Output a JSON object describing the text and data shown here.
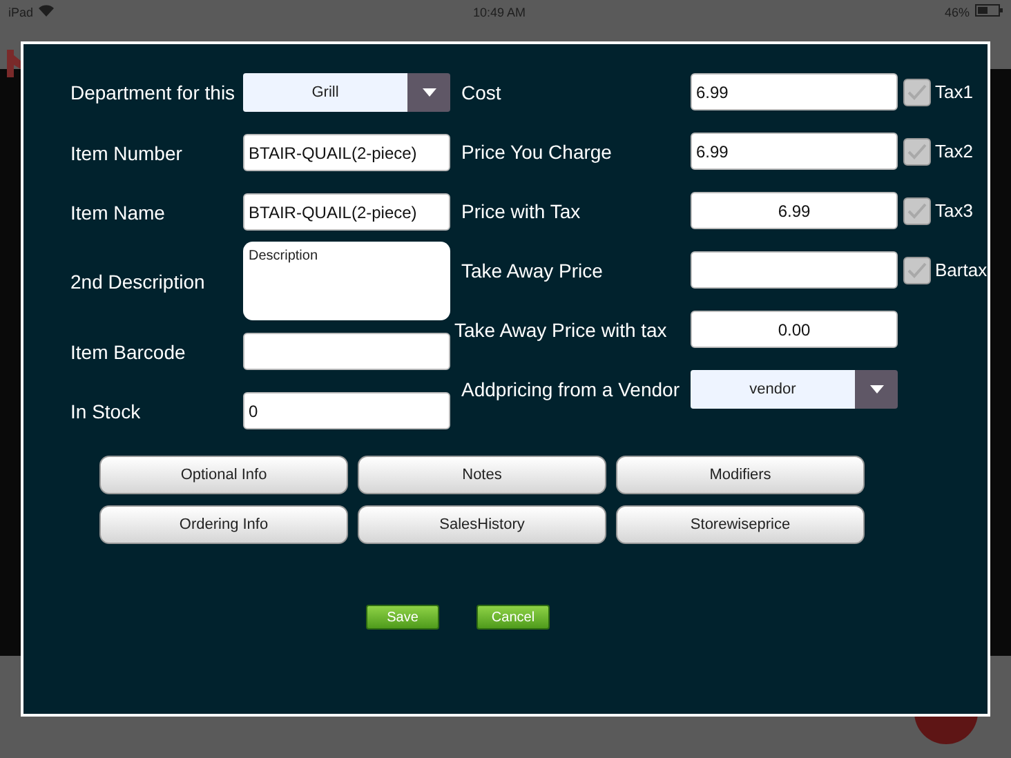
{
  "status_bar": {
    "device": "iPad",
    "time": "10:49 AM",
    "battery": "46%"
  },
  "dialog": {
    "left_fields": [
      {
        "label": "Department for this",
        "kind": "select",
        "value": "Grill"
      },
      {
        "label": "Item Number",
        "kind": "text",
        "value": "BTAIR-QUAIL(2-piece)"
      },
      {
        "label": "Item Name",
        "kind": "text",
        "value": "BTAIR-QUAIL(2-piece)"
      },
      {
        "label": "2nd Description",
        "kind": "textarea",
        "value": "Description"
      },
      {
        "label": "Item Barcode",
        "kind": "text"
      },
      {
        "label": "In Stock",
        "kind": "text",
        "value": "0"
      }
    ],
    "right_fields": [
      {
        "label": "Cost",
        "kind": "text",
        "value": "6.99",
        "tax": {
          "label": "Tax1",
          "checked": true
        }
      },
      {
        "label": "Price You Charge",
        "kind": "text",
        "value": "6.99",
        "tax": {
          "label": "Tax2",
          "checked": true
        }
      },
      {
        "label": "Price with Tax",
        "kind": "computed",
        "value": "6.99",
        "tax": {
          "label": "Tax3",
          "checked": true
        }
      },
      {
        "label": "Take Away Price",
        "kind": "text",
        "tax": {
          "label": "Bartax",
          "checked": true
        }
      },
      {
        "label": "Take Away Price with tax",
        "kind": "computed",
        "value": "0.00"
      },
      {
        "label": "Addpricing from a Vendor",
        "kind": "select",
        "value": "vendor"
      }
    ],
    "buttons": [
      [
        "Optional Info",
        "Notes",
        "Modifiers"
      ],
      [
        "Ordering Info",
        "SalesHistory",
        "Storewiseprice"
      ]
    ],
    "actions": [
      "Save",
      "Cancel"
    ]
  }
}
